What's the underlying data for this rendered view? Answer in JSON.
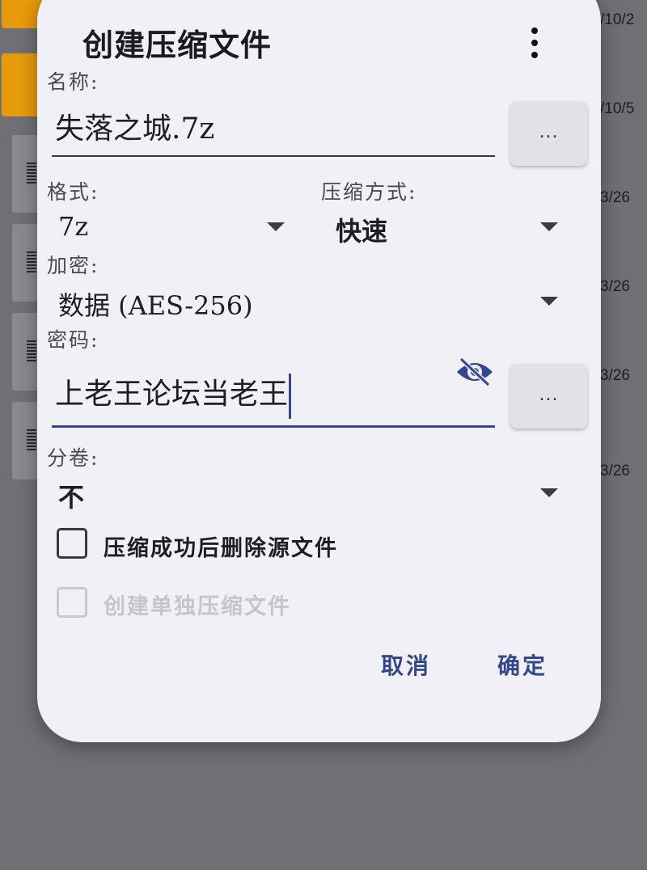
{
  "background": {
    "dates": [
      "/10/2",
      "/10/5",
      "3/26",
      "3/26",
      "3/26",
      "3/26"
    ]
  },
  "dialog": {
    "title": "创建压缩文件",
    "menu_icon": "more-vertical-icon",
    "name_label": "名称:",
    "name_value": "失落之城.7z",
    "browse_label": "...",
    "format_label": "格式:",
    "format_value": "7z",
    "method_label": "压缩方式:",
    "method_value": "快速",
    "encryption_label": "加密:",
    "encryption_value": "数据 (AES-256)",
    "password_label": "密码:",
    "password_value": "上老王论坛当老王",
    "password_icon": "eye-off-icon",
    "password_btn_label": "...",
    "split_label": "分卷:",
    "split_value": "不",
    "delete_after_label": "压缩成功后删除源文件",
    "delete_after_checked": false,
    "separate_archive_label": "创建单独压缩文件",
    "separate_archive_checked": false,
    "cancel_label": "取消",
    "ok_label": "确定",
    "accent_color": "#33478a"
  }
}
